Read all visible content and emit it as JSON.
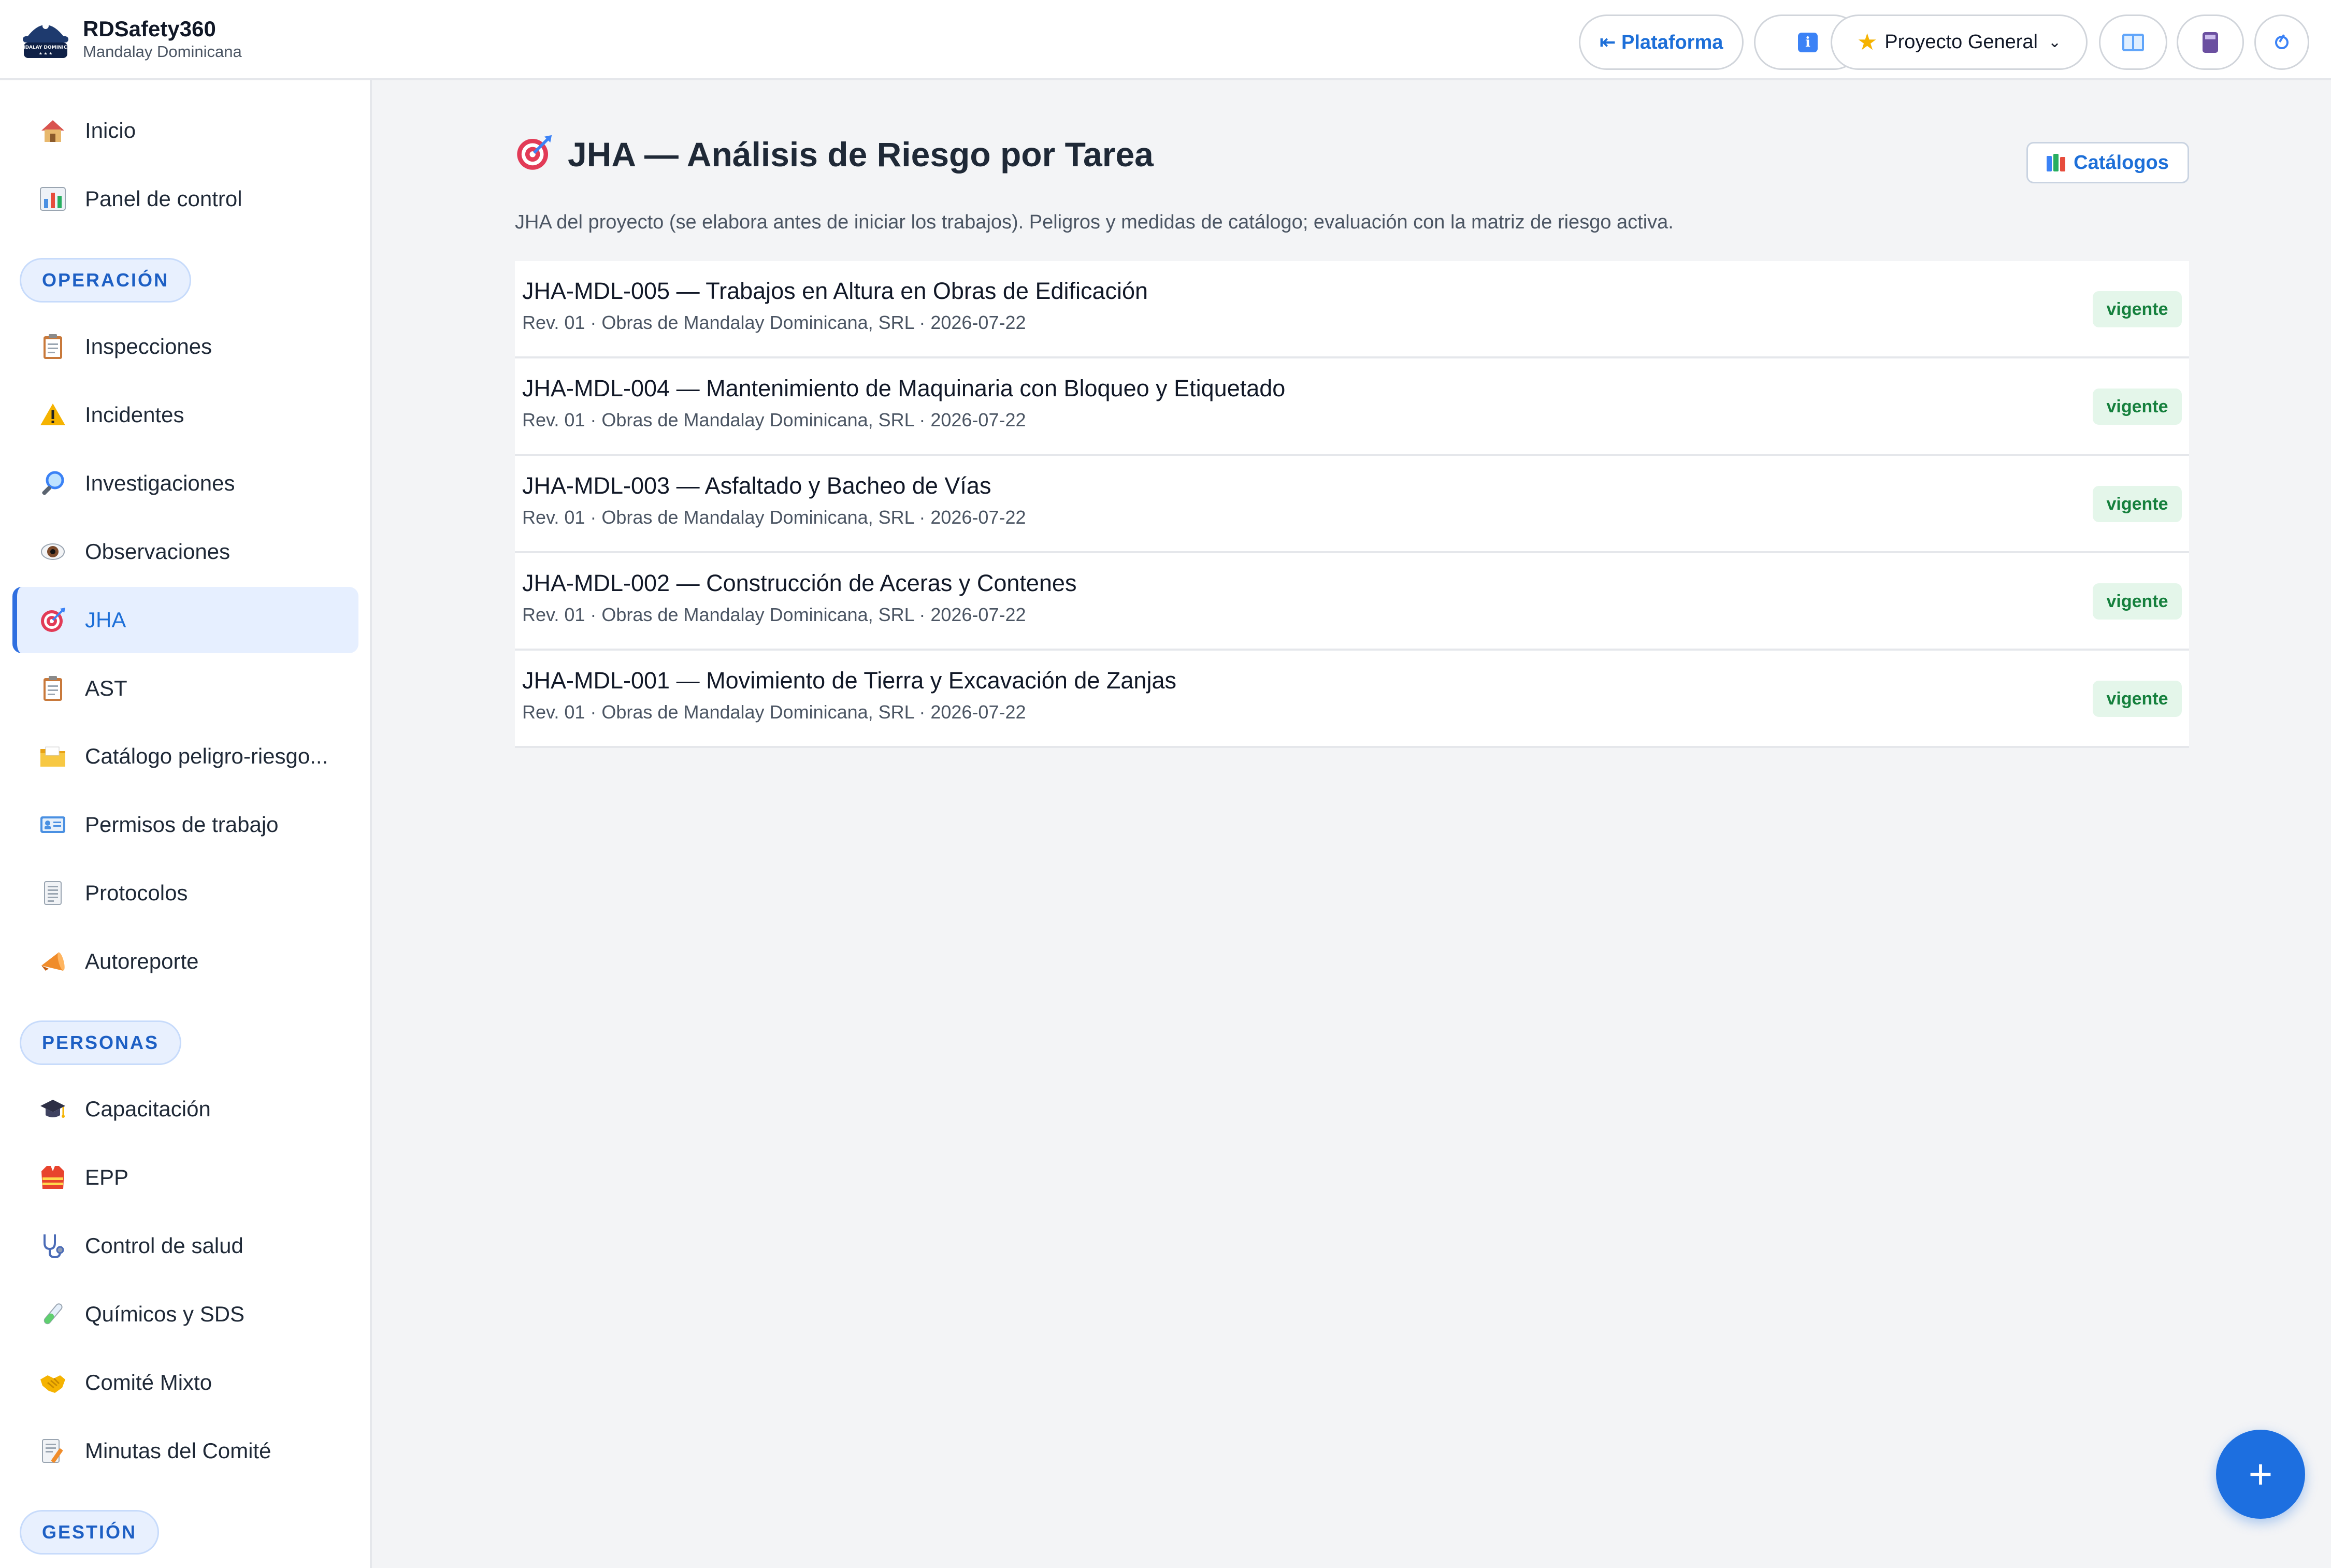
{
  "app": {
    "name": "RDSafety360",
    "organization": "Mandalay Dominicana",
    "logo_text": "MANDALAY DOMINICANA"
  },
  "toolbar": {
    "platform_button": "⇤ Plataforma",
    "project_select": "Proyecto General",
    "icons": [
      "info-icon",
      "star-icon",
      "chevron-down-icon",
      "manual-book-icon",
      "calculator-icon",
      "logout-icon"
    ]
  },
  "sidebar": {
    "sections": [
      {
        "label": "OPERACIÓN",
        "items": [
          {
            "label": "Inspecciones",
            "icon": "clipboard-icon"
          },
          {
            "label": "Incidentes",
            "icon": "warning-icon"
          },
          {
            "label": "Investigaciones",
            "icon": "magnifier-icon"
          },
          {
            "label": "Observaciones",
            "icon": "eye-icon"
          },
          {
            "label": "JHA",
            "icon": "target-icon",
            "active": true
          },
          {
            "label": "AST",
            "icon": "clipboard-icon"
          },
          {
            "label": "Catálogo peligro-riesgo...",
            "icon": "folder-icon"
          },
          {
            "label": "Permisos de trabajo",
            "icon": "id-card-icon"
          },
          {
            "label": "Protocolos",
            "icon": "document-icon"
          },
          {
            "label": "Autoreporte",
            "icon": "megaphone-icon"
          }
        ]
      },
      {
        "label": "PERSONAS",
        "items": [
          {
            "label": "Capacitación",
            "icon": "graduation-cap-icon"
          },
          {
            "label": "EPP",
            "icon": "safety-vest-icon"
          },
          {
            "label": "Control de salud",
            "icon": "stethoscope-icon"
          },
          {
            "label": "Químicos y SDS",
            "icon": "test-tube-icon"
          },
          {
            "label": "Comité Mixto",
            "icon": "handshake-icon"
          },
          {
            "label": "Minutas del Comité",
            "icon": "memo-icon"
          }
        ]
      },
      {
        "label": "GESTIÓN",
        "items": []
      }
    ],
    "top_items": [
      {
        "label": "Inicio",
        "icon": "house-icon"
      },
      {
        "label": "Panel de control",
        "icon": "bar-chart-icon"
      }
    ]
  },
  "main": {
    "title": "JHA — Análisis de Riesgo por Tarea",
    "title_icon": "target-icon",
    "catalogos_button": "Catálogos",
    "description": "JHA del proyecto (se elabora antes de iniciar los trabajos). Peligros y medidas de catálogo; evaluación con la matriz de riesgo activa.",
    "jha_list": [
      {
        "title": "JHA-MDL-005 — Trabajos en Altura en Obras de Edificación",
        "meta": "Rev. 01 · Obras de Mandalay Dominicana, SRL · 2026-07-22",
        "status": "vigente"
      },
      {
        "title": "JHA-MDL-004 — Mantenimiento de Maquinaria con Bloqueo y Etiquetado",
        "meta": "Rev. 01 · Obras de Mandalay Dominicana, SRL · 2026-07-22",
        "status": "vigente"
      },
      {
        "title": "JHA-MDL-003 — Asfaltado y Bacheo de Vías",
        "meta": "Rev. 01 · Obras de Mandalay Dominicana, SRL · 2026-07-22",
        "status": "vigente"
      },
      {
        "title": "JHA-MDL-002 — Construcción de Aceras y Contenes",
        "meta": "Rev. 01 · Obras de Mandalay Dominicana, SRL · 2026-07-22",
        "status": "vigente"
      },
      {
        "title": "JHA-MDL-001 — Movimiento de Tierra y Excavación de Zanjas",
        "meta": "Rev. 01 · Obras de Mandalay Dominicana, SRL · 2026-07-22",
        "status": "vigente"
      }
    ],
    "fab_label": "+"
  },
  "colors": {
    "accent": "#1d6fd8",
    "active_bg": "#e6efff",
    "status_bg": "#e4f6ea",
    "status_text": "#15803d",
    "page_bg": "#f3f4f6"
  }
}
